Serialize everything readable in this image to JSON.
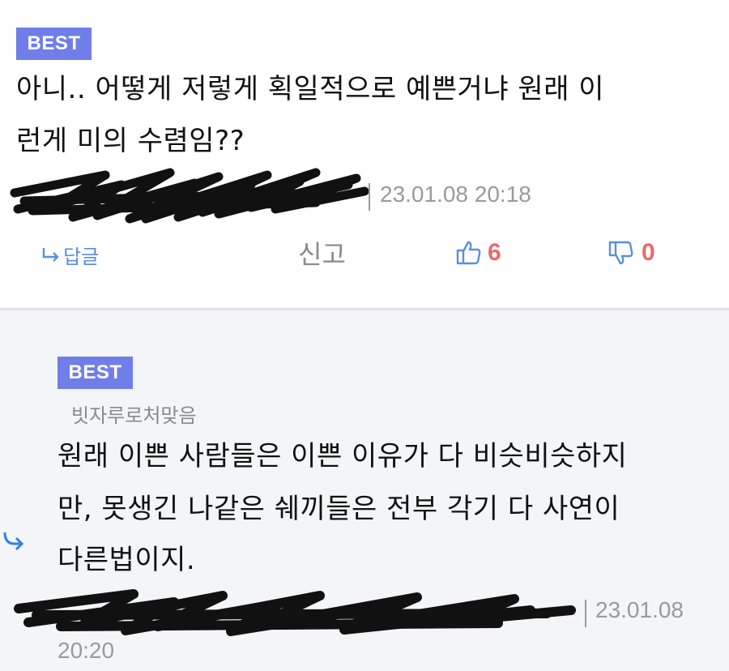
{
  "comment1": {
    "badge": "BEST",
    "text_line1": "아니.. 어떻게 저렇게 획일적으로 예쁜거냐 원래 이",
    "text_line2": "런게 미의 수렴임??",
    "date": "23.01.08 20:18",
    "actions": {
      "reply_label": "답글",
      "report_label": "신고",
      "like_count": "6",
      "dislike_count": "0"
    }
  },
  "comment2": {
    "badge": "BEST",
    "parent_ref": "빗자루로처맞음",
    "text_line1": "원래 이쁜 사람들은 이쁜 이유가 다 비슷비슷하지",
    "text_line2": "만, 못생긴 나같은 쉐끼들은 전부 각기 다 사연이",
    "text_line3": "다른법이지.",
    "date_part1": "23.01.08",
    "date_part2": "20:20"
  },
  "colors": {
    "badge_bg": "#6f7ee8",
    "like_count": "#e86b6b",
    "icon_blue": "#5a8ee0",
    "meta_gray": "#9a9a9a"
  },
  "icons": [
    "reply-arrow-icon",
    "thumbs-up-icon",
    "thumbs-down-icon",
    "reply-indent-arrow-icon"
  ]
}
